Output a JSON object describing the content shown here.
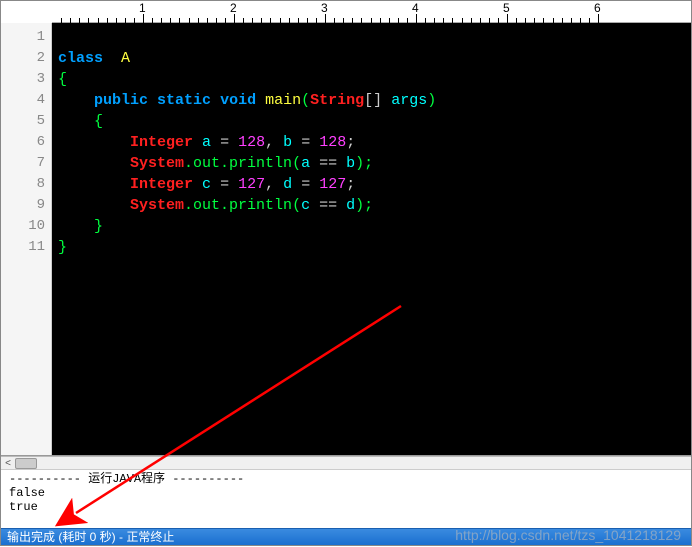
{
  "ruler": {
    "major": [
      1,
      2,
      3,
      4,
      5
    ]
  },
  "gutter": [
    "1",
    "2",
    "3",
    "4",
    "5",
    "6",
    "7",
    "8",
    "9",
    "10",
    "11"
  ],
  "code": {
    "l1": {
      "kw_class": "class",
      "cls": "A"
    },
    "l2": {
      "brace": "{"
    },
    "l3": {
      "kw_public": "public",
      "kw_static": "static",
      "kw_void": "void",
      "mname": "main",
      "type": "String",
      "sq": "[]",
      "arg": "args"
    },
    "l4": {
      "brace": "{"
    },
    "l5": {
      "type": "Integer",
      "a": "a",
      "eq1": "=",
      "n1": "128",
      "cm": ",",
      "b": "b",
      "eq2": "=",
      "n2": "128",
      "sc": ";"
    },
    "l6": {
      "sys": "System",
      "out": ".out.",
      "prn": "println",
      "lp": "(",
      "a": "a",
      "eq": " == ",
      "b": "b",
      "rp": ");"
    },
    "l7": {
      "type": "Integer",
      "a": "c",
      "eq1": "=",
      "n1": "127",
      "cm": ",",
      "b": "d",
      "eq2": "=",
      "n2": "127",
      "sc": ";"
    },
    "l8": {
      "sys": "System",
      "out": ".out.",
      "prn": "println",
      "lp": "(",
      "a": "c",
      "eq": " == ",
      "b": "d",
      "rp": ");"
    },
    "l9": {
      "brace": "}"
    },
    "l10": {
      "brace": "}"
    }
  },
  "console": {
    "header": "---------- 运行JAVA程序 ----------",
    "o1": "false",
    "o2": "true"
  },
  "status": "输出完成 (耗时 0 秒) - 正常终止",
  "watermark": "http://blog.csdn.net/tzs_1041218129"
}
